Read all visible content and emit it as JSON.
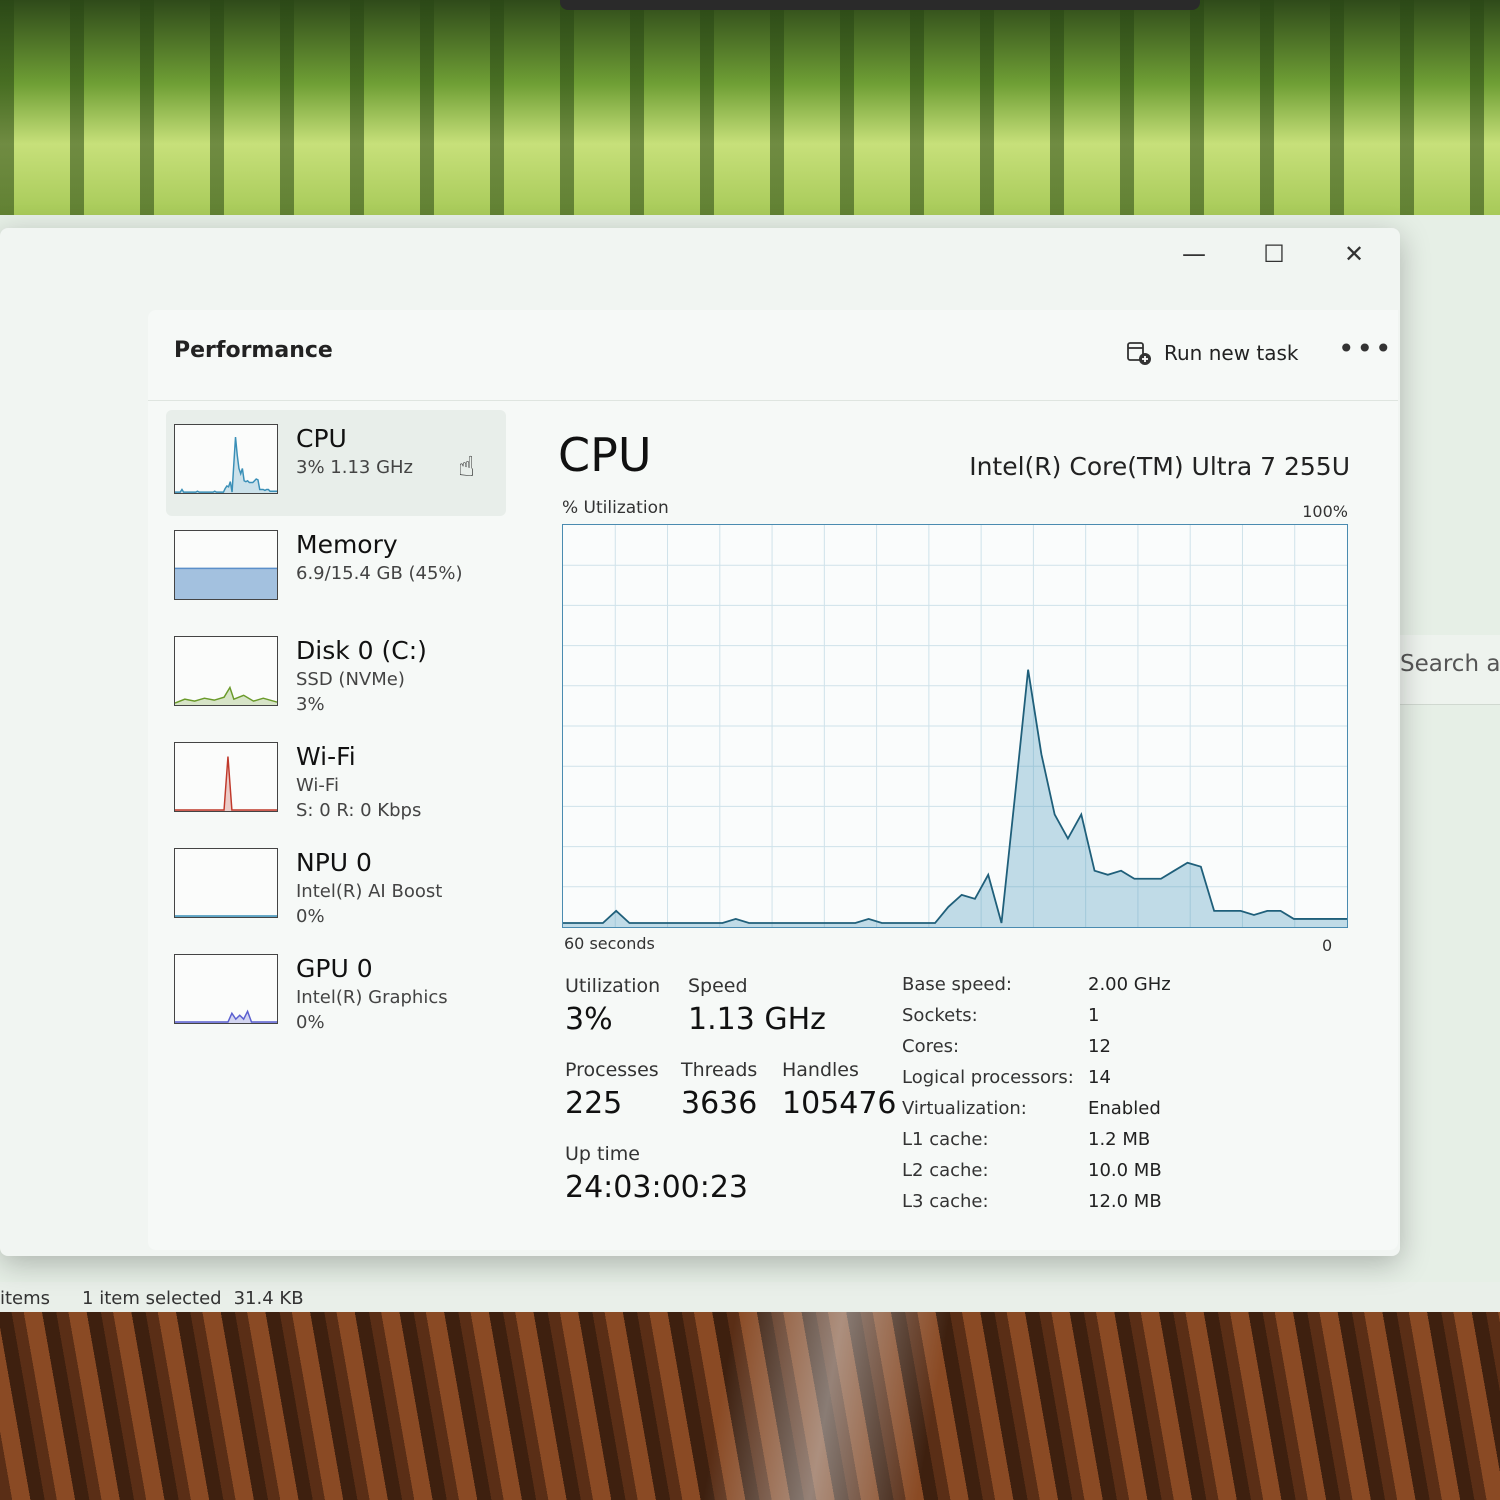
{
  "window": {
    "controls": {
      "minimize": "—",
      "maximize": "☐",
      "close": "✕"
    }
  },
  "header": {
    "title": "Performance",
    "run_new_task": "Run new task",
    "more": "•••"
  },
  "background": {
    "search_placeholder": "Search ad",
    "status": {
      "items": "items",
      "selected": "1 item selected",
      "size": "31.4 KB"
    }
  },
  "sidebar": {
    "items": [
      {
        "name": "CPU",
        "sub1": "3%  1.13 GHz",
        "sub2": "",
        "color": "#3a8fb7"
      },
      {
        "name": "Memory",
        "sub1": "6.9/15.4 GB (45%)",
        "sub2": "",
        "color": "#5b8fc9"
      },
      {
        "name": "Disk 0 (C:)",
        "sub1": "SSD (NVMe)",
        "sub2": "3%",
        "color": "#6a9a2a"
      },
      {
        "name": "Wi-Fi",
        "sub1": "Wi-Fi",
        "sub2": "S: 0 R: 0 Kbps",
        "color": "#c0392b"
      },
      {
        "name": "NPU 0",
        "sub1": "Intel(R) AI Boost",
        "sub2": "0%",
        "color": "#3a8fb7"
      },
      {
        "name": "GPU 0",
        "sub1": "Intel(R) Graphics",
        "sub2": "0%",
        "color": "#5a5fd0"
      }
    ],
    "memory_fill": 0.45
  },
  "main": {
    "title": "CPU",
    "model": "Intel(R) Core(TM) Ultra 7 255U",
    "util_label": "% Utilization",
    "util_max": "100%",
    "axis_left": "60 seconds",
    "axis_right": "0",
    "graph_color": "#3a8fb7",
    "history": [
      1,
      1,
      1,
      1,
      4,
      1,
      1,
      1,
      1,
      1,
      1,
      1,
      1,
      2,
      1,
      1,
      1,
      1,
      1,
      1,
      1,
      1,
      1,
      2,
      1,
      1,
      1,
      1,
      1,
      5,
      8,
      7,
      13,
      1,
      32,
      64,
      43,
      28,
      22,
      28,
      14,
      13,
      14,
      12,
      12,
      12,
      14,
      16,
      15,
      4,
      4,
      4,
      3,
      4,
      4,
      2,
      2,
      2,
      2,
      2
    ],
    "stats": {
      "utilization_label": "Utilization",
      "utilization": "3%",
      "speed_label": "Speed",
      "speed": "1.13 GHz",
      "processes_label": "Processes",
      "processes": "225",
      "threads_label": "Threads",
      "threads": "3636",
      "handles_label": "Handles",
      "handles": "105476",
      "uptime_label": "Up time",
      "uptime": "24:03:00:23"
    },
    "specs": [
      {
        "key": "Base speed:",
        "val": "2.00 GHz"
      },
      {
        "key": "Sockets:",
        "val": "1"
      },
      {
        "key": "Cores:",
        "val": "12"
      },
      {
        "key": "Logical processors:",
        "val": "14"
      },
      {
        "key": "Virtualization:",
        "val": "Enabled"
      },
      {
        "key": "L1 cache:",
        "val": "1.2 MB"
      },
      {
        "key": "L2 cache:",
        "val": "10.0 MB"
      },
      {
        "key": "L3 cache:",
        "val": "12.0 MB"
      }
    ]
  }
}
